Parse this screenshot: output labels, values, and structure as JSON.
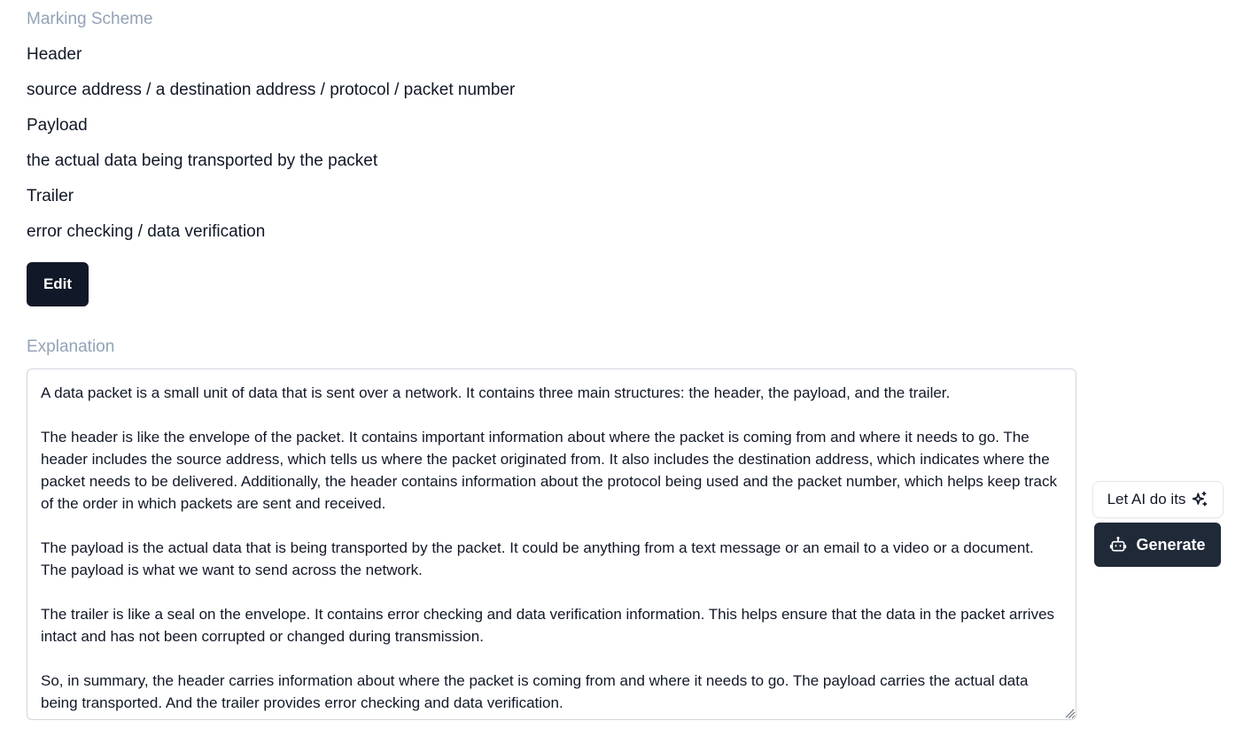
{
  "marking_scheme": {
    "label": "Marking Scheme",
    "lines": [
      "Header",
      "source address / a destination address / protocol / packet number",
      "Payload",
      "the actual data being transported by the packet",
      "Trailer",
      "error checking / data verification"
    ],
    "edit_label": "Edit"
  },
  "explanation": {
    "label": "Explanation",
    "paragraphs": [
      "A data packet is a small unit of data that is sent over a network. It contains three main structures: the header, the payload, and the trailer.",
      "The header is like the envelope of the packet. It contains important information about where the packet is coming from and where it needs to go. The header includes the source address, which tells us where the packet originated from. It also includes the destination address, which indicates where the packet needs to be delivered. Additionally, the header contains information about the protocol being used and the packet number, which helps keep track of the order in which packets are sent and received.",
      "The payload is the actual data that is being transported by the packet. It could be anything from a text message or an email to a video or a document. The payload is what we want to send across the network.",
      "The trailer is like a seal on the envelope. It contains error checking and data verification information. This helps ensure that the data in the packet arrives intact and has not been corrupted or changed during transmission.",
      "So, in summary, the header carries information about where the packet is coming from and where it needs to go. The payload carries the actual data being transported. And the trailer provides error checking and data verification."
    ]
  },
  "ai": {
    "hint_label": "Let AI do its",
    "hint_icon": "sparkles-icon",
    "generate_label": "Generate",
    "generate_icon": "robot-icon"
  },
  "colors": {
    "label_gray": "#94a3b8",
    "button_dark": "#111827",
    "generate_dark": "#1f2937"
  }
}
